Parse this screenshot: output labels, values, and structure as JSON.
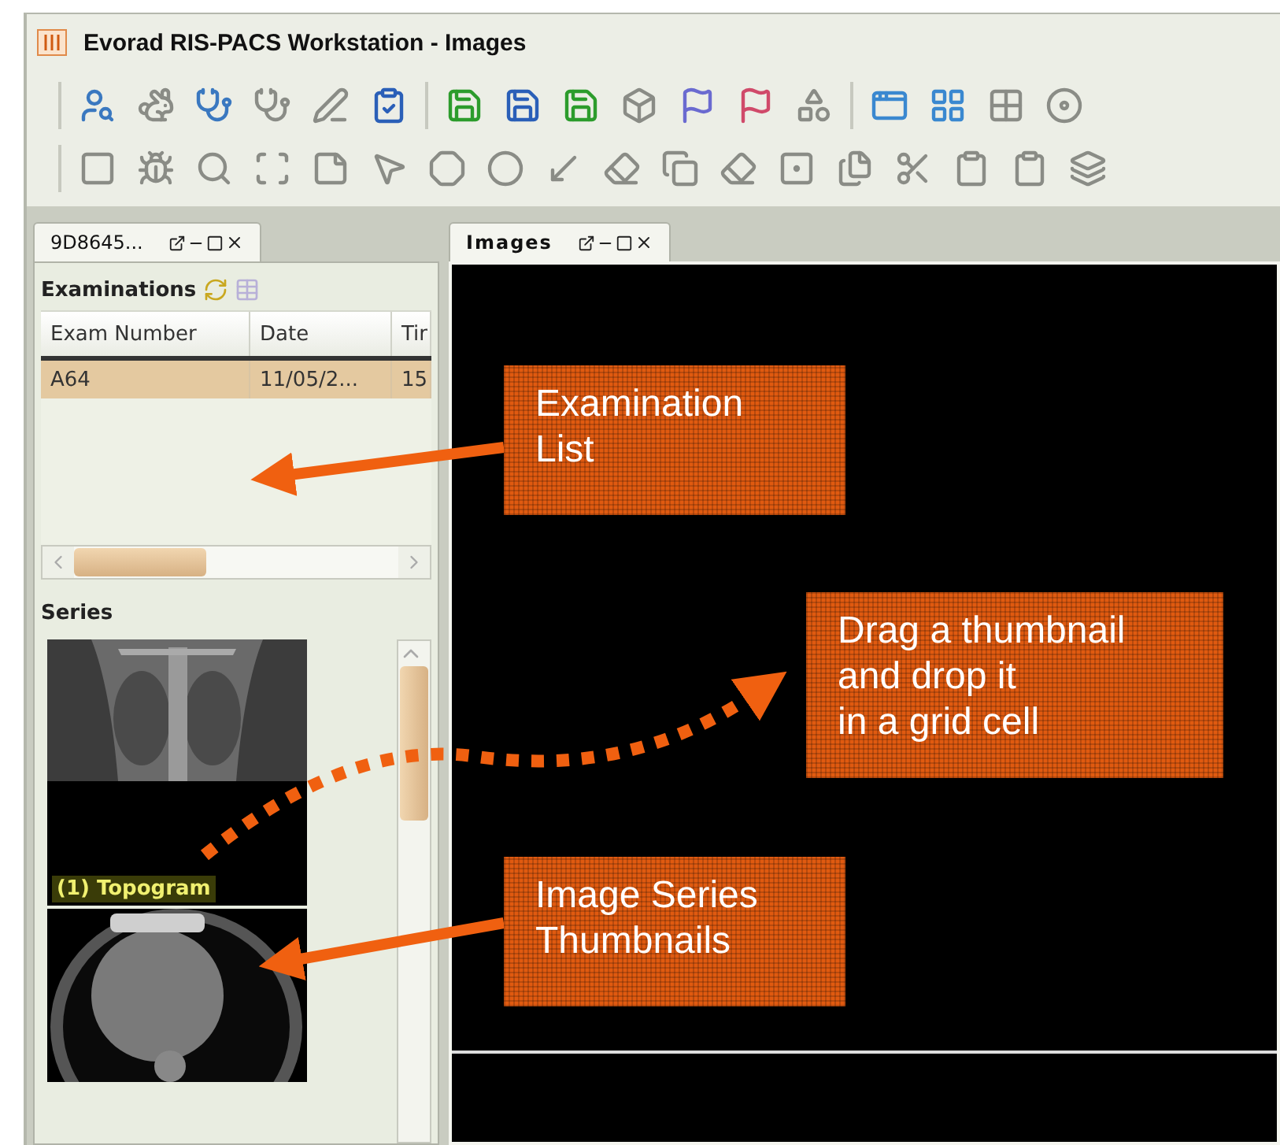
{
  "window": {
    "title": "Evorad RIS-PACS Workstation - Images"
  },
  "left_panel": {
    "tab": {
      "label": "9D8645...",
      "selected": true
    },
    "examinations": {
      "title": "Examinations",
      "columns": [
        "Exam Number",
        "Date",
        "Tir"
      ],
      "rows": [
        {
          "cells": [
            "A64",
            "11/05/2...",
            "15"
          ],
          "selected": true
        }
      ]
    },
    "series": {
      "title": "Series",
      "thumbnails": [
        {
          "kind": "xray",
          "label": "(1) Topogram"
        },
        {
          "kind": "ct"
        }
      ]
    }
  },
  "images_panel": {
    "tab": {
      "label": "Images",
      "selected": true
    }
  },
  "callouts": [
    {
      "text": "Examination\nList"
    },
    {
      "text": "Drag a thumbnail\nand drop it\nin a grid cell"
    },
    {
      "text": "Image Series\nThumbnails"
    }
  ]
}
